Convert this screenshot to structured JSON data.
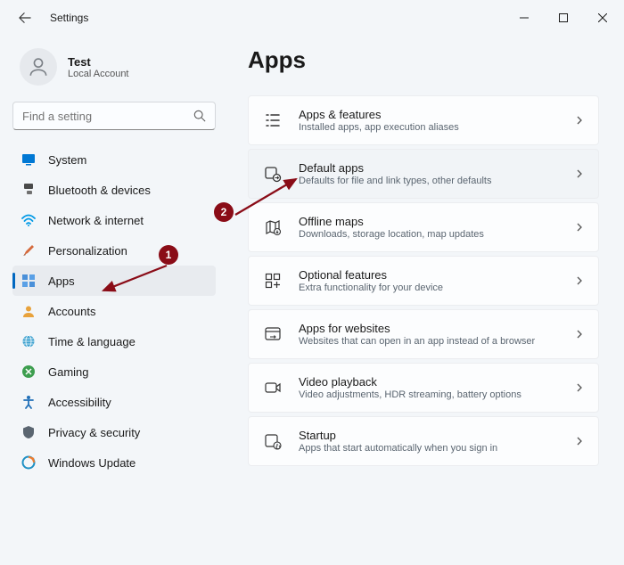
{
  "titlebar": {
    "title": "Settings"
  },
  "user": {
    "name": "Test",
    "sub": "Local Account"
  },
  "search": {
    "placeholder": "Find a setting"
  },
  "sidebar": {
    "items": [
      {
        "label": "System"
      },
      {
        "label": "Bluetooth & devices"
      },
      {
        "label": "Network & internet"
      },
      {
        "label": "Personalization"
      },
      {
        "label": "Apps"
      },
      {
        "label": "Accounts"
      },
      {
        "label": "Time & language"
      },
      {
        "label": "Gaming"
      },
      {
        "label": "Accessibility"
      },
      {
        "label": "Privacy & security"
      },
      {
        "label": "Windows Update"
      }
    ]
  },
  "page": {
    "title": "Apps"
  },
  "cards": [
    {
      "title": "Apps & features",
      "sub": "Installed apps, app execution aliases"
    },
    {
      "title": "Default apps",
      "sub": "Defaults for file and link types, other defaults"
    },
    {
      "title": "Offline maps",
      "sub": "Downloads, storage location, map updates"
    },
    {
      "title": "Optional features",
      "sub": "Extra functionality for your device"
    },
    {
      "title": "Apps for websites",
      "sub": "Websites that can open in an app instead of a browser"
    },
    {
      "title": "Video playback",
      "sub": "Video adjustments, HDR streaming, battery options"
    },
    {
      "title": "Startup",
      "sub": "Apps that start automatically when you sign in"
    }
  ],
  "annotations": {
    "badge1": "1",
    "badge2": "2"
  },
  "colors": {
    "accent": "#0067c0",
    "badge": "#8a0c17",
    "arrow": "#8a0c17"
  }
}
